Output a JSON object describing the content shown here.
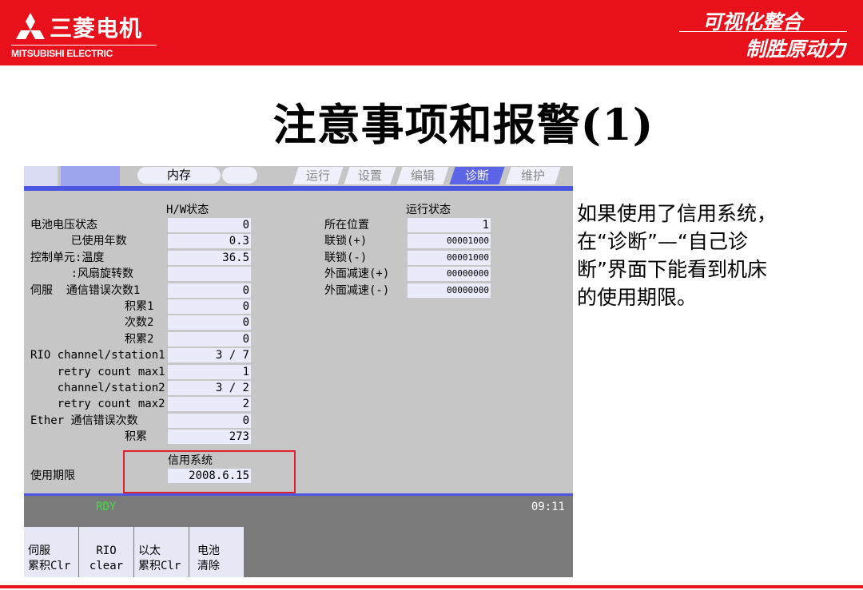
{
  "brand": {
    "name_cn": "三菱电机",
    "name_en": "MITSUBISHI ELECTRIC",
    "logo_icon": "three-diamonds-icon",
    "color": "#e8101a"
  },
  "slogan": {
    "line1": "可视化整合",
    "line2": "制胜原动力"
  },
  "title": "注意事项和报警(1)",
  "note": "如果使用了信用系统，在“诊断”—“自己诊断”界面下能看到机床的使用期限。",
  "screen": {
    "topbar": {
      "memory_label": "内存"
    },
    "tabs": [
      {
        "label": "运行",
        "active": false
      },
      {
        "label": "设置",
        "active": false
      },
      {
        "label": "编辑",
        "active": false
      },
      {
        "label": "诊断",
        "active": true
      },
      {
        "label": "维护",
        "active": false
      }
    ],
    "hw": {
      "header": "H/W状态",
      "rows": [
        {
          "label": "电池电压状态",
          "value": "0"
        },
        {
          "label": "      已使用年数",
          "value": "0.3"
        },
        {
          "label": "控制单元:温度",
          "value": "36.5"
        },
        {
          "label": "      :风扇旋转数",
          "value": ""
        },
        {
          "label": "伺服  通信错误次数1",
          "value": "0"
        },
        {
          "label": "              积累1",
          "value": "0"
        },
        {
          "label": "              次数2",
          "value": "0"
        },
        {
          "label": "              积累2",
          "value": "0"
        },
        {
          "label": "RIO channel/station1",
          "value": "3 / 7"
        },
        {
          "label": "    retry count max1",
          "value": "1"
        },
        {
          "label": "    channel/station2",
          "value": "3 / 2"
        },
        {
          "label": "    retry count max2",
          "value": "2"
        },
        {
          "label": "Ether 通信错误次数",
          "value": "0"
        },
        {
          "label": "              积累",
          "value": "273"
        }
      ]
    },
    "op": {
      "header": "运行状态",
      "rows": [
        {
          "label": "所在位置",
          "value": "1"
        },
        {
          "label": "联锁(+)",
          "value": "00001000"
        },
        {
          "label": "联锁(-)",
          "value": "00001000"
        },
        {
          "label": "外面减速(+)",
          "value": "00000000"
        },
        {
          "label": "外面减速(-)",
          "value": "00000000"
        }
      ]
    },
    "credit": {
      "header": "信用系统",
      "label": "使用期限",
      "value": "2008.6.15"
    },
    "status": {
      "ready": "RDY",
      "time": "09:11"
    },
    "fkeys": [
      {
        "line1": "伺服",
        "line2": "累积Clr"
      },
      {
        "line1": "RIO",
        "line2": "clear"
      },
      {
        "line1": "以太",
        "line2": "累积Clr"
      },
      {
        "line1": "电池",
        "line2": "清除"
      }
    ]
  }
}
